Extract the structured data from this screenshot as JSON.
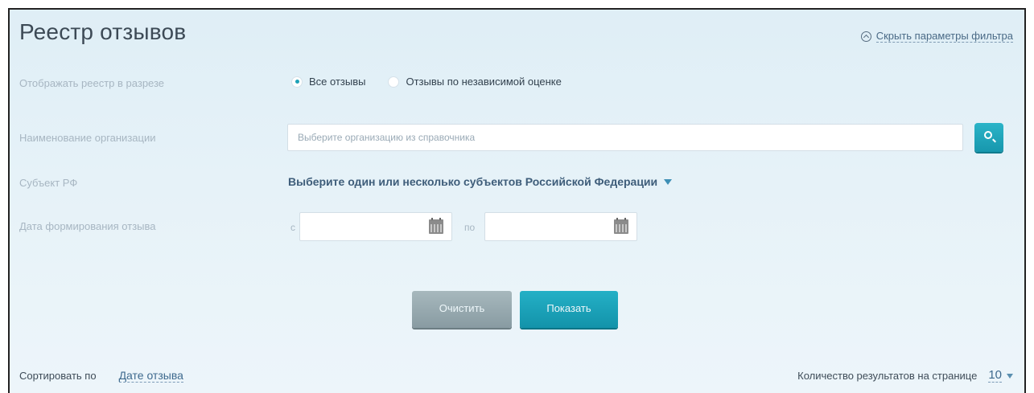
{
  "header": {
    "title": "Реестр отзывов",
    "hide_filter_label": "Скрыть параметры фильтра"
  },
  "filters": {
    "display_mode_label": "Отображать реестр в разрезе",
    "display_mode_options": [
      {
        "label": "Все отзывы",
        "checked": true
      },
      {
        "label": "Отзывы по независимой оценке",
        "checked": false
      }
    ],
    "org_label": "Наименование организации",
    "org_placeholder": "Выберите организацию из справочника",
    "region_label": "Субъект РФ",
    "region_value": "Выберите один или несколько субъектов Российской Федерации",
    "date_label": "Дата формирования отзыва",
    "date_from_prefix": "с",
    "date_to_prefix": "по",
    "date_from_value": "",
    "date_to_value": ""
  },
  "actions": {
    "clear_label": "Очистить",
    "show_label": "Показать"
  },
  "footer": {
    "sort_label": "Сортировать по",
    "sort_value": "Дате отзыва",
    "per_page_label": "Количество результатов на странице",
    "per_page_value": "10"
  },
  "colors": {
    "accent": "#1ea2b8",
    "background": "#e3f0f7",
    "link": "#3e6a8e",
    "muted_label": "#a7b6c2"
  },
  "icons": {
    "hide_filter": "chevron-up-circle-icon",
    "search": "search-icon",
    "region_dropdown": "triangle-down-icon",
    "calendar": "calendar-icon",
    "per_page_dropdown": "triangle-down-icon"
  }
}
